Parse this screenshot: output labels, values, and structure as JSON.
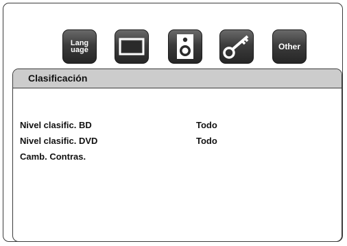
{
  "toolbar": {
    "items": [
      {
        "label": "Lang\nuage",
        "icon": "language-icon"
      },
      {
        "label": "",
        "icon": "display-icon"
      },
      {
        "label": "",
        "icon": "speaker-icon"
      },
      {
        "label": "",
        "icon": "key-icon"
      },
      {
        "label": "Other",
        "icon": "other-icon"
      }
    ]
  },
  "panel": {
    "title": "Clasificación",
    "rows": [
      {
        "label": "Nivel clasific. BD",
        "value": "Todo"
      },
      {
        "label": "Nivel clasific. DVD",
        "value": "Todo"
      },
      {
        "label": "Camb. Contras.",
        "value": ""
      }
    ]
  },
  "colors": {
    "header_bg": "#cccccc",
    "icon_bg": "#3c3c3c",
    "border": "#3a3a3a"
  }
}
